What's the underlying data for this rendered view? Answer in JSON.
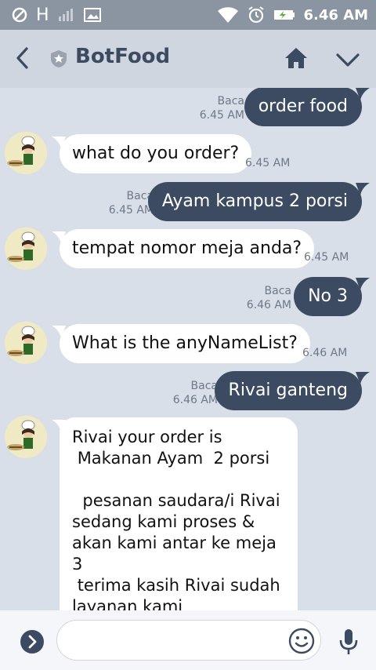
{
  "status": {
    "network": "H",
    "time": "6.46 AM"
  },
  "header": {
    "title": "BotFood"
  },
  "messages": [
    {
      "side": "out",
      "text": "order food",
      "read": "Baca",
      "time": "6.45 AM"
    },
    {
      "side": "in",
      "text": "what do you order?",
      "time": "6.45 AM"
    },
    {
      "side": "out",
      "text": "Ayam kampus 2 porsi",
      "read": "Baca",
      "time": "6.45 AM"
    },
    {
      "side": "in",
      "text": "tempat nomor meja anda?",
      "time": "6.45 AM"
    },
    {
      "side": "out",
      "text": "No 3",
      "read": "Baca",
      "time": "6.46 AM"
    },
    {
      "side": "in",
      "text": "What is the anyNameList?",
      "time": "6.46 AM"
    },
    {
      "side": "out",
      "text": "Rivai ganteng",
      "read": "Baca",
      "time": "6.46 AM"
    },
    {
      "side": "in",
      "text": "Rivai your order is\n Makanan Ayam  2 porsi\n\n  pesanan saudara/i Rivai sedang kami proses & akan kami antar ke meja 3\n terima kasih Rivai sudah layanan kami"
    }
  ],
  "input": {
    "placeholder": ""
  },
  "colors": {
    "accent": "#3c4b61",
    "chat_bg": "#d9dfe8",
    "header_bg": "#cfd6e0"
  },
  "icons": [
    "blocked-icon",
    "signal-icon",
    "image-icon",
    "wifi-icon",
    "alarm-icon",
    "battery-icon",
    "back-chevron-icon",
    "shield-icon",
    "home-icon",
    "chevron-down-icon",
    "send-arrow-icon",
    "emoji-icon",
    "microphone-icon"
  ]
}
